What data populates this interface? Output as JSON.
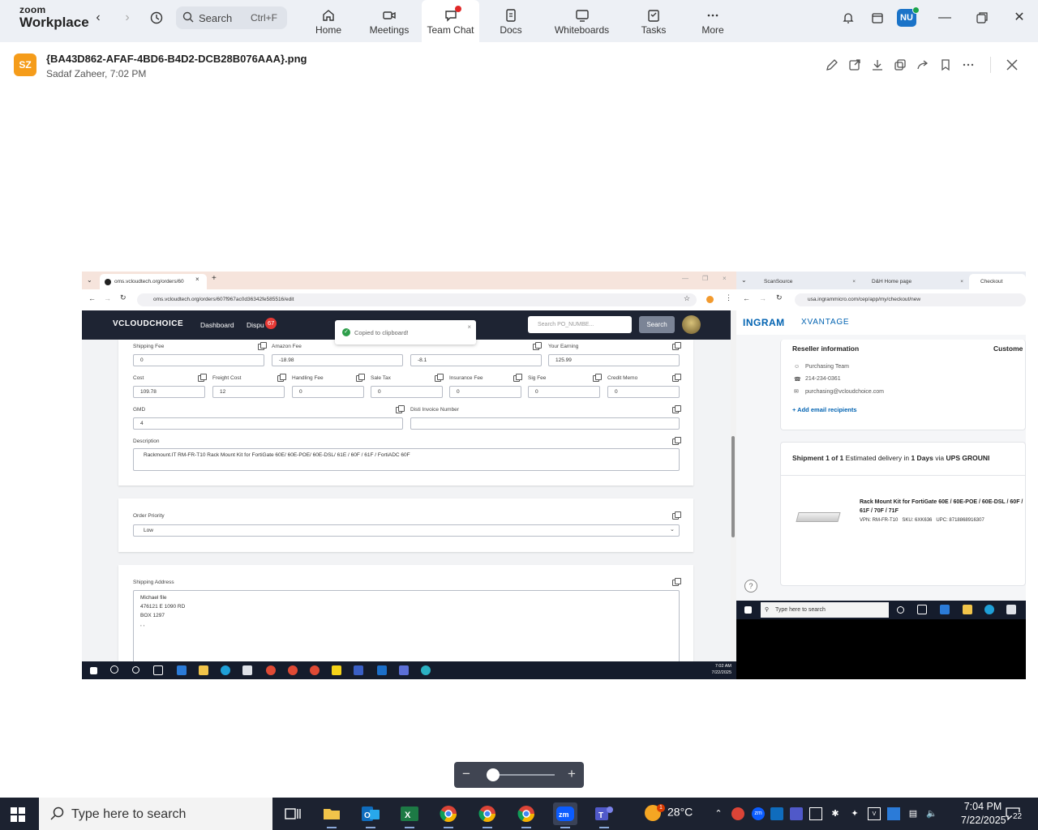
{
  "zoom": {
    "brand_small": "zoom",
    "brand_large": "Workplace",
    "search_label": "Search",
    "search_shortcut": "Ctrl+F",
    "tabs": [
      {
        "label": "Home",
        "icon": "home-icon"
      },
      {
        "label": "Meetings",
        "icon": "video-camera-icon"
      },
      {
        "label": "Team Chat",
        "icon": "chat-icon",
        "active": true
      },
      {
        "label": "Docs",
        "icon": "document-icon"
      },
      {
        "label": "Whiteboards",
        "icon": "whiteboard-icon"
      },
      {
        "label": "Tasks",
        "icon": "tasks-icon"
      },
      {
        "label": "More",
        "icon": "more-dots-icon"
      }
    ],
    "user_initials": "NU"
  },
  "file": {
    "avatar_initials": "SZ",
    "name": "{BA43D862-AFAF-4BD6-B4D2-DCB28B076AAA}.png",
    "meta": "Sadaf Zaheer, 7:02 PM"
  },
  "screenshot": {
    "left": {
      "tab_title": "oms.vcloudtech.org/orders/60",
      "url": "oms.vcloudtech.org/orders/607f967ac0d36342fe585516/edit",
      "logo": "VCLOUDCHOICE",
      "nav_dashboard": "Dashboard",
      "nav_disputes": "Dispu",
      "disputes_count": "67",
      "search_placeholder": "Search PO_NUMBE...",
      "search_button": "Search",
      "toast": "Copied to clipboard!",
      "fields_row1": [
        {
          "label": "Shipping Fee",
          "value": "0"
        },
        {
          "label": "Amazon Fee",
          "value": "-18.98"
        },
        {
          "label": "",
          "value": "-8.1"
        },
        {
          "label": "Your Earning",
          "value": "125.99"
        }
      ],
      "fields_row2": [
        {
          "label": "Cost",
          "value": "109.78"
        },
        {
          "label": "Freight Cost",
          "value": "12"
        },
        {
          "label": "Handling Fee",
          "value": "0"
        },
        {
          "label": "Sale Tax",
          "value": "0"
        },
        {
          "label": "Insurance Fee",
          "value": "0"
        },
        {
          "label": "Sig Fee",
          "value": "0"
        },
        {
          "label": "Credit Memo",
          "value": "0"
        }
      ],
      "gmd_label": "GMD",
      "gmd_value": "4",
      "dist_invoice_label": "Disti Invoice Number",
      "dist_invoice_value": "",
      "description_label": "Description",
      "description_value": "Rackmount.IT RM-FR-T10 Rack Mount Kit for FortiGate 60E/ 60E-POE/ 60E-DSL/ 61E / 60F / 61F / FortiADC 60F",
      "order_priority_label": "Order Priority",
      "order_priority_value": "Low",
      "shipping_address_label": "Shipping Address",
      "shipping_address_lines": [
        "Michael file",
        "476121 E 1090 RD",
        "BOX 1297",
        ", ,"
      ],
      "clock_time": "7:02 AM",
      "clock_date": "7/22/2025"
    },
    "right": {
      "tabs": [
        "ScanSource",
        "D&H Home page",
        "Checkout"
      ],
      "url": "usa.ingrammicro.com/cep/app/my/checkout/new",
      "logo": "INGRAM",
      "logo_suffix": "XVANTAGE",
      "reseller_title": "Reseller information",
      "customer_label": "Custome",
      "reseller_team": "Purchasing Team",
      "reseller_phone": "214-234-0361",
      "reseller_email": "purchasing@vcloudchoice.com",
      "add_email": "+ Add email recipients",
      "shipment_title": "Shipment 1 of 1",
      "shipment_est": "Estimated delivery in",
      "shipment_days": "1 Days",
      "shipment_via": "via",
      "shipment_carrier": "UPS GROUNI",
      "product_title": "Rack Mount Kit for FortiGate 60E / 60E-POE / 60E-DSL / 60F / 61F / 70F / 71F",
      "product_vpn": "VPN: RM-FR-T10",
      "product_sku": "SKU: 6XK636",
      "product_upc": "UPC: 8718868916307",
      "taskbar_search": "Type here to search"
    }
  },
  "zoom_slider": {
    "level": 0.05
  },
  "taskbar": {
    "search_placeholder": "Type here to search",
    "weather": "28°C",
    "weather_badge": "1",
    "time": "7:04 PM",
    "date": "7/22/2025",
    "notifications": "22"
  },
  "colors": {
    "zoom_bar": "#edf0f5",
    "accent_blue": "#0b5cff",
    "notification_red": "#e02828",
    "oms_nav": "#1e2433"
  }
}
